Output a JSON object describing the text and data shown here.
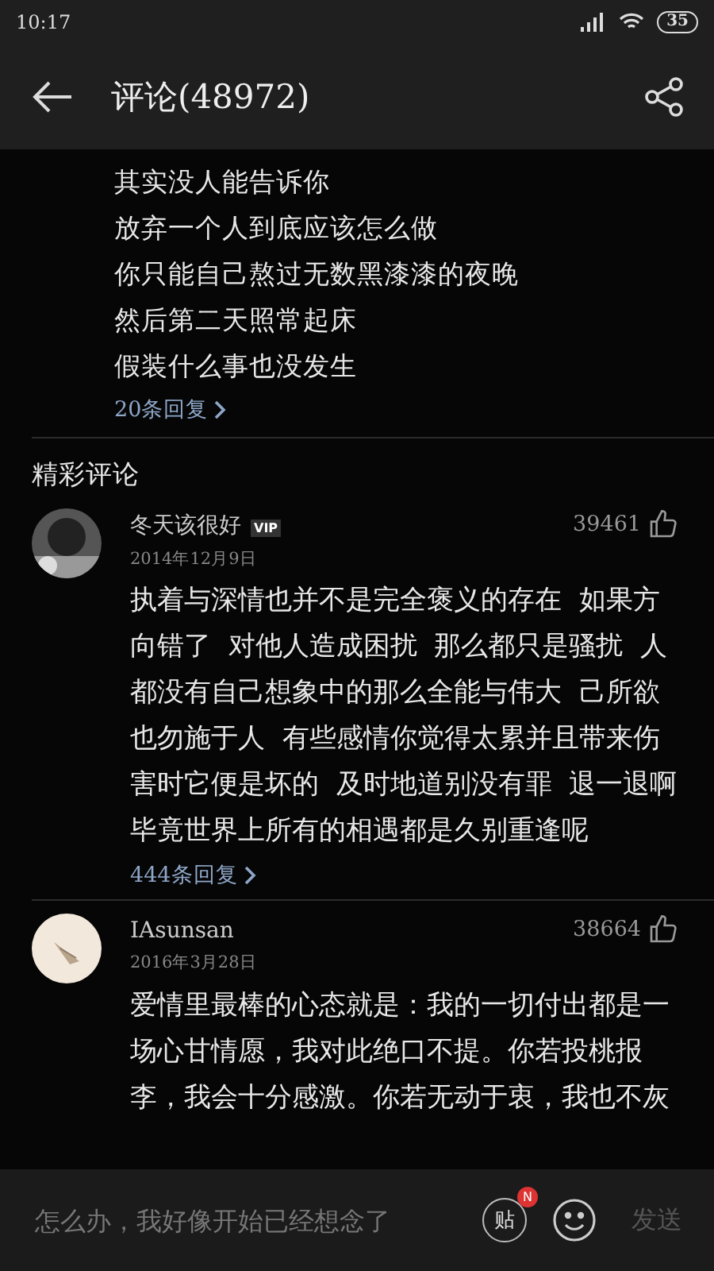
{
  "status_bar": {
    "time": "10:17",
    "battery": "35"
  },
  "header": {
    "title": "评论(48972)"
  },
  "top_comment": {
    "lines": [
      "其实没人能告诉你",
      "放弃一个人到底应该怎么做",
      "你只能自己熬过无数黑漆漆的夜晚",
      "然后第二天照常起床",
      "假装什么事也没发生"
    ],
    "replies": "20条回复"
  },
  "section_title": "精彩评论",
  "comments": [
    {
      "name": "冬天该很好",
      "vip": "VIP",
      "date": "2014年12月9日",
      "likes": "39461",
      "body": "执着与深情也并不是完全褒义的存在  如果方向错了  对他人造成困扰  那么都只是骚扰  人都没有自己想象中的那么全能与伟大  己所欲也勿施于人  有些感情你觉得太累并且带来伤害时它便是坏的  及时地道别没有罪  退一退啊毕竟世界上所有的相遇都是久别重逢呢",
      "replies": "444条回复"
    },
    {
      "name": "IAsunsan",
      "date": "2016年3月28日",
      "likes": "38664",
      "body": "爱情里最棒的心态就是：我的一切付出都是一场心甘情愿，我对此绝口不提。你若投桃报李，我会十分感激。你若无动于衷，我也不灰"
    }
  ],
  "composer": {
    "placeholder": "怎么办，我好像开始已经想念了",
    "post_label": "贴",
    "post_badge": "N",
    "send": "发送",
    "send_disabled": true
  }
}
